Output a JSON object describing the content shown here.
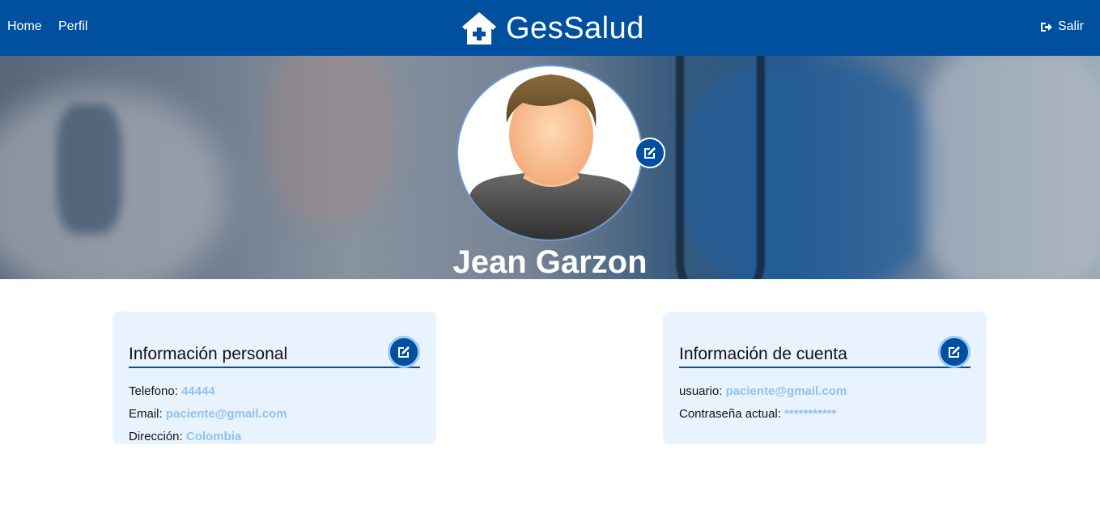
{
  "nav": {
    "home": "Home",
    "perfil": "Perfil",
    "brand": "GesSalud",
    "logout": "Salir"
  },
  "profile": {
    "name": "Jean Garzon"
  },
  "personal": {
    "title": "Información personal",
    "rows": [
      {
        "label": "Telefono:",
        "value": "44444"
      },
      {
        "label": "Email:",
        "value": "paciente@gmail.com"
      },
      {
        "label": "Dirección:",
        "value": "Colombia"
      }
    ]
  },
  "account": {
    "title": "Información de cuenta",
    "rows": [
      {
        "label": "usuario:",
        "value": "paciente@gmail.com"
      },
      {
        "label": "Contraseña actual:",
        "value": "***********"
      }
    ]
  },
  "colors": {
    "navbar": "#00509f",
    "card_bg": "#e9f3fd",
    "value_text": "#8fc3f0",
    "divider": "#0b4f8c"
  },
  "icons": {
    "brand": "house-medical-icon",
    "logout": "sign-out-icon",
    "edit": "edit-icon",
    "avatar": "user-avatar"
  }
}
